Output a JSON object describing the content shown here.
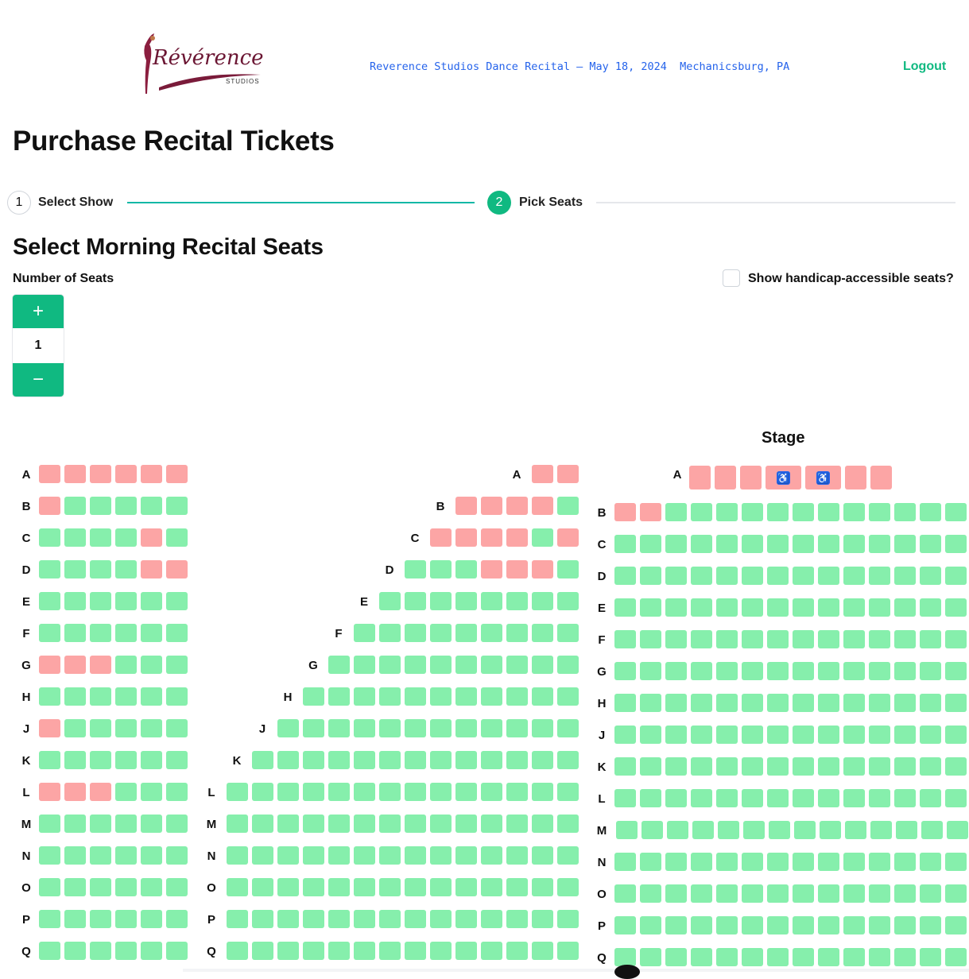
{
  "header": {
    "title": "Reverence Studios Dance Recital – May 18, 2024  Mechanicsburg, PA",
    "logout_label": "Logout",
    "logo_text": "Révérence",
    "logo_subtext": "STUDIOS"
  },
  "page_title": "Purchase Recital Tickets",
  "steps": [
    {
      "number": "1",
      "label": "Select Show"
    },
    {
      "number": "2",
      "label": "Pick Seats"
    }
  ],
  "section_title": "Select Morning Recital Seats",
  "seat_count": {
    "label": "Number of Seats",
    "value": "1",
    "plus": "+",
    "minus": "−"
  },
  "accessible_toggle": {
    "label": "Show handicap-accessible seats?",
    "checked": false
  },
  "stage_label": "Stage",
  "colors": {
    "available": "#86efac",
    "sold": "#fca5a5",
    "accent": "#10b981",
    "accessible": "#2563eb"
  },
  "legend_symbols": {
    "accessible": "♿"
  },
  "sections": {
    "left": {
      "rows": [
        {
          "label": "A",
          "seats": "xxxxxx"
        },
        {
          "label": "B",
          "seats": "xooooo"
        },
        {
          "label": "C",
          "seats": "ooooxo"
        },
        {
          "label": "D",
          "seats": "ooooxx"
        },
        {
          "label": "E",
          "seats": "oooooo"
        },
        {
          "label": "F",
          "seats": "oooooo"
        },
        {
          "label": "G",
          "seats": "xxxooo"
        },
        {
          "label": "H",
          "seats": "oooooo"
        },
        {
          "label": "J",
          "seats": "xooooo"
        },
        {
          "label": "K",
          "seats": "oooooo"
        },
        {
          "label": "L",
          "seats": "xxxooo"
        },
        {
          "label": "M",
          "seats": "oooooo"
        },
        {
          "label": "N",
          "seats": "oooooo"
        },
        {
          "label": "O",
          "seats": "oooooo"
        },
        {
          "label": "P",
          "seats": "oooooo"
        },
        {
          "label": "Q",
          "seats": "oooooo"
        }
      ]
    },
    "center": {
      "rows": [
        {
          "label": "A",
          "seats": "xx"
        },
        {
          "label": "B",
          "seats": "xxxxo"
        },
        {
          "label": "C",
          "seats": "xxxxox"
        },
        {
          "label": "D",
          "seats": "oooxxxo"
        },
        {
          "label": "E",
          "seats": "oooooooo"
        },
        {
          "label": "F",
          "seats": "ooooooooo"
        },
        {
          "label": "G",
          "seats": "oooooooooo"
        },
        {
          "label": "H",
          "seats": "ooooooooooo"
        },
        {
          "label": "J",
          "seats": "oooooooooooo"
        },
        {
          "label": "K",
          "seats": "ooooooooooooo"
        },
        {
          "label": "L",
          "seats": "oooooooooooooo"
        },
        {
          "label": "M",
          "seats": "oooooooooooooo"
        },
        {
          "label": "N",
          "seats": "oooooooooooooo"
        },
        {
          "label": "O",
          "seats": "oooooooooooooo"
        },
        {
          "label": "P",
          "seats": "oooooooooooooo"
        },
        {
          "label": "Q",
          "seats": "oooooooooooooo"
        }
      ]
    },
    "right": {
      "row_a": {
        "label": "A",
        "seats": "xxxaaxx"
      },
      "rows": [
        {
          "label": "B",
          "seats": "xxoooooooooooo"
        },
        {
          "label": "C",
          "seats": "oooooooooooooo"
        },
        {
          "label": "D",
          "seats": "oooooooooooooo"
        },
        {
          "label": "E",
          "seats": "oooooooooooooo"
        },
        {
          "label": "F",
          "seats": "oooooooooooooo"
        },
        {
          "label": "G",
          "seats": "oooooooooooooo"
        },
        {
          "label": "H",
          "seats": "oooooooooooooo"
        },
        {
          "label": "J",
          "seats": "oooooooooooooo"
        },
        {
          "label": "K",
          "seats": "oooooooooooooo"
        },
        {
          "label": "L",
          "seats": "oooooooooooooo"
        },
        {
          "label": "M",
          "seats": "oooooooooooooo"
        },
        {
          "label": "N",
          "seats": "oooooooooooooo"
        },
        {
          "label": "O",
          "seats": "oooooooooooooo"
        },
        {
          "label": "P",
          "seats": "oooooooooooooo"
        },
        {
          "label": "Q",
          "seats": "oooooooooooooo"
        }
      ]
    }
  }
}
